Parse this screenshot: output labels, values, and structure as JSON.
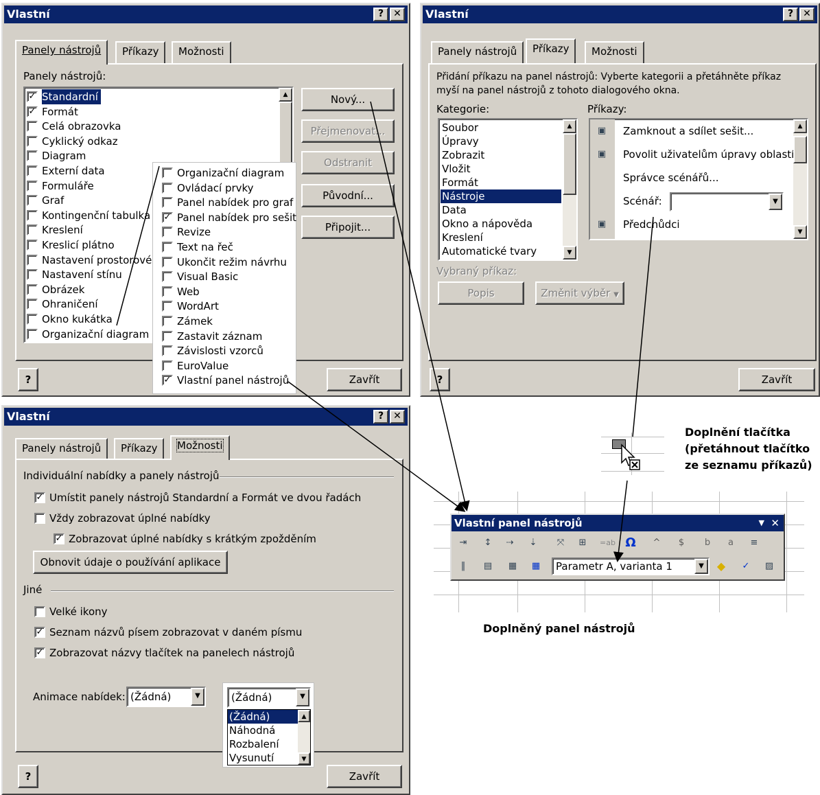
{
  "win1": {
    "title": "Vlastní",
    "tabs": [
      "Panely nástrojů",
      "Příkazy",
      "Možnosti"
    ],
    "list_label": "Panely nástrojů:",
    "toolbars": [
      {
        "label": "Standardní",
        "checked": true,
        "selected": true
      },
      {
        "label": "Formát",
        "checked": true
      },
      {
        "label": "Celá obrazovka",
        "checked": false
      },
      {
        "label": "Cyklický odkaz",
        "checked": false
      },
      {
        "label": "Diagram",
        "checked": false
      },
      {
        "label": "Externí data",
        "checked": false
      },
      {
        "label": "Formuláře",
        "checked": false
      },
      {
        "label": "Graf",
        "checked": false
      },
      {
        "label": "Kontingenční tabulka",
        "checked": false
      },
      {
        "label": "Kreslení",
        "checked": false
      },
      {
        "label": "Kreslicí plátno",
        "checked": false
      },
      {
        "label": "Nastavení prostorové",
        "checked": false
      },
      {
        "label": "Nastavení stínu",
        "checked": false
      },
      {
        "label": "Obrázek",
        "checked": false
      },
      {
        "label": "Ohraničení",
        "checked": false
      },
      {
        "label": "Okno kukátka",
        "checked": false
      },
      {
        "label": "Organizační diagram",
        "checked": false
      }
    ],
    "buttons": {
      "new": "Nový...",
      "rename": "Přejmenovat...",
      "delete": "Odstranit",
      "reset": "Původní...",
      "attach": "Připojit..."
    },
    "close": "Zavřít"
  },
  "popout_list": [
    {
      "label": "Organizační diagram",
      "checked": false
    },
    {
      "label": "Ovládací prvky",
      "checked": false
    },
    {
      "label": "Panel nabídek pro graf",
      "checked": false
    },
    {
      "label": "Panel nabídek pro sešit",
      "checked": true
    },
    {
      "label": "Revize",
      "checked": false
    },
    {
      "label": "Text na řeč",
      "checked": false
    },
    {
      "label": "Ukončit režim návrhu",
      "checked": false
    },
    {
      "label": "Visual Basic",
      "checked": false
    },
    {
      "label": "Web",
      "checked": false
    },
    {
      "label": "WordArt",
      "checked": false
    },
    {
      "label": "Zámek",
      "checked": false
    },
    {
      "label": "Zastavit záznam",
      "checked": false
    },
    {
      "label": "Závislosti vzorců",
      "checked": false
    },
    {
      "label": "EuroValue",
      "checked": false
    },
    {
      "label": "Vlastní panel nástrojů",
      "checked": true
    }
  ],
  "win2": {
    "title": "Vlastní",
    "tabs": [
      "Panely nástrojů",
      "Příkazy",
      "Možnosti"
    ],
    "description_line1": "Přidání příkazu na panel nástrojů: Vyberte kategorii a přetáhněte příkaz",
    "description_line2": "myší na panel nástrojů z tohoto dialogového okna.",
    "categories_label": "Kategorie:",
    "commands_label": "Příkazy:",
    "categories": [
      "Soubor",
      "Úpravy",
      "Zobrazit",
      "Vložit",
      "Formát",
      "Nástroje",
      "Data",
      "Okno a nápověda",
      "Kreslení",
      "Automatické tvary"
    ],
    "selected_category": "Nástroje",
    "commands": [
      {
        "label": "Zamknout a sdílet sešit...",
        "icon": "share-workbook-icon"
      },
      {
        "label": "Povolit uživatelům úpravy oblastí...",
        "icon": "allow-edit-ranges-icon"
      },
      {
        "label": "Správce scénářů...",
        "icon": ""
      },
      {
        "label": "Scénář:",
        "icon": ""
      },
      {
        "label": "Předchůdci",
        "icon": "trace-precedents-icon"
      }
    ],
    "selected_command_label": "Vybraný příkaz:",
    "description_btn": "Popis",
    "modify_btn": "Změnit výběr",
    "close": "Zavřít"
  },
  "win3": {
    "title": "Vlastní",
    "tabs": [
      "Panely nástrojů",
      "Příkazy",
      "Možnosti"
    ],
    "group1": "Individuální nabídky a panely nástrojů",
    "opt1": "Umístit panely nástrojů Standardní a Formát ve dvou řadách",
    "opt2": "Vždy zobrazovat úplné nabídky",
    "opt3": "Zobrazovat úplné nabídky s krátkým zpožděním",
    "reset_btn": "Obnovit údaje o používání aplikace",
    "group2": "Jiné",
    "opt4": "Velké ikony",
    "opt5": "Seznam názvů písem zobrazovat v daném písmu",
    "opt6": "Zobrazovat názvy tlačítek na panelech nástrojů",
    "anim_label": "Animace nabídek:",
    "anim_value": "(Žádná)",
    "close": "Zavřít"
  },
  "anim_dropdown": {
    "value": "(Žádná)",
    "options": [
      "(Žádná)",
      "Náhodná",
      "Rozbalení",
      "Vysunutí"
    ]
  },
  "custom_toolbar": {
    "title": "Vlastní panel nástrojů",
    "param_value": "Parametr A, varianta 1"
  },
  "captions": {
    "add_button_line1": "Doplnění tlačítka",
    "add_button_line2": "(přetáhnout tlačítko",
    "add_button_line3": "ze seznamu příkazů)",
    "result": "Doplněný panel nástrojů"
  }
}
